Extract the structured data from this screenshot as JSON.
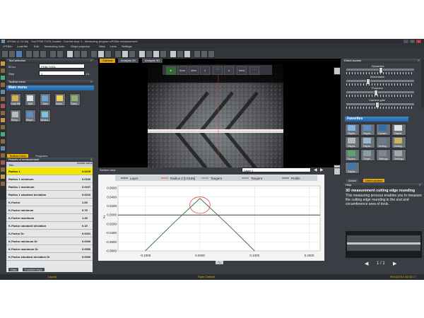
{
  "window": {
    "title": "zPOMz (1.14.5d) - Tool POM-TOOL loaded - Current step: 1 - Measuring program zPOMz measurement",
    "controls": [
      "–",
      "□",
      "×"
    ]
  },
  "menubar": [
    "»POM«",
    "Load file",
    "Edit",
    "Measuring tools",
    "Stripe projector",
    "View",
    "Lens",
    "Settings"
  ],
  "left": {
    "tool_panel_title": "Tool selection",
    "id_label": "ID no.",
    "id_value": "POM-TOOL",
    "step_label": "Step",
    "step_value": "1",
    "step_count": "1/1",
    "toolbar_menu_title": "Toolbar menu",
    "main_menu_title": "Main menu",
    "main_buttons": [
      {
        "label": "Load file"
      },
      {
        "label": "Edit"
      },
      {
        "label": "View"
      },
      {
        "label": "Incide..."
      },
      {
        "label": "Trans..."
      },
      {
        "label": "Setup..."
      },
      {
        "label": "Stripe..."
      },
      {
        "label": "Measu..."
      }
    ],
    "tabs": [
      "Toolbar menu",
      "Programs"
    ],
    "results_title": "Results of measurement",
    "results_headers": [
      "Title",
      "Actual value"
    ],
    "results": [
      {
        "name": "Radius 1",
        "value": "0.0219",
        "highlight": true
      },
      {
        "name": "Radius 1 minimum",
        "value": "0.0160"
      },
      {
        "name": "Radius 1 maximum",
        "value": "0.0237"
      },
      {
        "name": "Radius 1 standard deviation",
        "value": "0.0016"
      },
      {
        "name": "K-Factor",
        "value": "1.05"
      },
      {
        "name": "K-Factor minimum",
        "value": "0.79"
      },
      {
        "name": "K-Factor maximum",
        "value": "1.49"
      },
      {
        "name": "K-Factor standard deviation",
        "value": "0.15"
      },
      {
        "name": "K-Factor Dr",
        "value": "0.0001"
      },
      {
        "name": "K-Factor minimum Dr",
        "value": "0.0000"
      },
      {
        "name": "K-Factor maximum Dr",
        "value": "0.0000"
      },
      {
        "name": "K-Factor standard deviation Dr",
        "value": "0.0000"
      }
    ],
    "bottom_tabs": [
      "Data",
      "Function keys"
    ]
  },
  "viewport": {
    "tabs": [
      "Camera",
      "Analysis 2D",
      "Analysis 3D"
    ],
    "active_tab": "Camera",
    "cam_buttons": [
      "►",
      "Auto",
      "Man",
      "‖",
      "⌒",
      "∧",
      "Next",
      "⌃"
    ]
  },
  "section": {
    "title": "Section view",
    "layer": "Layer 1",
    "legend": [
      "Layer",
      "Radius 2 [0.0185]",
      "Tangent",
      "Tangent",
      "Profile"
    ],
    "ylabel": "Z"
  },
  "chart_data": {
    "type": "line",
    "title": "",
    "xlabel": "",
    "ylabel": "Z",
    "xlim": [
      -0.15,
      0.22
    ],
    "ylim": [
      -0.08,
      0.065
    ],
    "x_ticks": [
      "-0.1000",
      "0.0000",
      "0.1000",
      "0.2000"
    ],
    "y_ticks": [
      "0.0600",
      "0.0400",
      "0.0200",
      "0.0000",
      "-0.0200",
      "-0.0400",
      "-0.0600",
      "-0.0800"
    ],
    "series": [
      {
        "name": "Layer",
        "color": "#3c3c3c",
        "x": [
          -0.15,
          0.22
        ],
        "y": [
          0.0,
          0.0
        ]
      },
      {
        "name": "Profile",
        "color": "#3a6a3a",
        "x": [
          -0.1,
          -0.05,
          0.0,
          0.05,
          0.1
        ],
        "y": [
          -0.08,
          -0.02,
          0.037,
          -0.02,
          -0.08
        ]
      }
    ],
    "circle": {
      "name": "Radius 2 [0.0185]",
      "cx": 0.0,
      "cy": 0.022,
      "r": 0.0185,
      "color": "#e04848"
    },
    "grid": true,
    "legend": "top"
  },
  "right": {
    "direct_access_title": "Direct access",
    "sliders": [
      {
        "label": "Dynamics",
        "pos": 0.5
      },
      {
        "label": "Illumination",
        "pos": 0.3
      },
      {
        "label": "Projector",
        "pos": 0.42
      },
      {
        "label": "Camera gain",
        "pos": 0.45
      }
    ],
    "favorites_title": "Favorites",
    "favorites": [
      "Displa...",
      "Displa...",
      "Dynam...",
      "Displa...",
      "Displa...",
      "Displa...",
      "Setting...",
      "Setting...",
      "Squaro...",
      "Stripe...",
      "Settings",
      "Settings",
      "Displa..."
    ],
    "action_tabs": [
      "Action",
      "Direct access"
    ],
    "help_title": "Help",
    "help_heading": "3D measurement cutting edge rounding",
    "help_body": "This measuring process enables you to measure the cutting edge rounding in the end and circumference area of tools.",
    "pager": "1 / 1"
  },
  "status": {
    "layout": "Layout:",
    "style": "Style: Default",
    "datetime": "09/12/2014 16:33:17"
  }
}
